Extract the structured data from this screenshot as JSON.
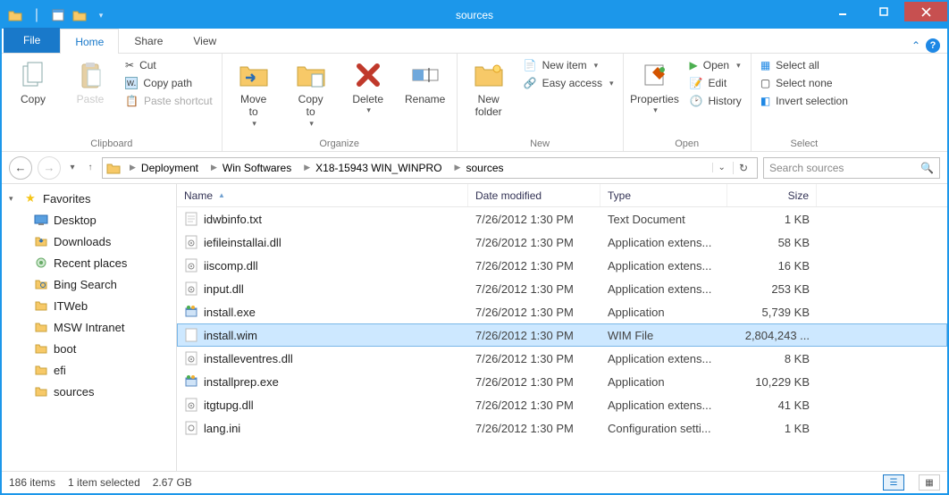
{
  "window": {
    "title": "sources"
  },
  "tabs": {
    "file": "File",
    "home": "Home",
    "share": "Share",
    "view": "View"
  },
  "ribbon": {
    "clipboard": {
      "label": "Clipboard",
      "copy": "Copy",
      "paste": "Paste",
      "cut": "Cut",
      "copy_path": "Copy path",
      "paste_shortcut": "Paste shortcut"
    },
    "organize": {
      "label": "Organize",
      "move_to": "Move\nto",
      "copy_to": "Copy\nto",
      "delete": "Delete",
      "rename": "Rename"
    },
    "new": {
      "label": "New",
      "new_folder": "New\nfolder",
      "new_item": "New item",
      "easy_access": "Easy access"
    },
    "open": {
      "label": "Open",
      "properties": "Properties",
      "open": "Open",
      "edit": "Edit",
      "history": "History"
    },
    "select": {
      "label": "Select",
      "all": "Select all",
      "none": "Select none",
      "invert": "Invert selection"
    }
  },
  "breadcrumbs": [
    "Deployment",
    "Win Softwares",
    "X18-15943 WIN_WINPRO",
    "sources"
  ],
  "search_placeholder": "Search sources",
  "nav": {
    "favorites": "Favorites",
    "items": [
      "Desktop",
      "Downloads",
      "Recent places",
      "Bing Search",
      "ITWeb",
      "MSW Intranet",
      "boot",
      "efi",
      "sources"
    ]
  },
  "columns": {
    "name": "Name",
    "date": "Date modified",
    "type": "Type",
    "size": "Size"
  },
  "files": [
    {
      "name": "idwbinfo.txt",
      "date": "7/26/2012 1:30 PM",
      "type": "Text Document",
      "size": "1 KB",
      "icon": "txt"
    },
    {
      "name": "iefileinstallai.dll",
      "date": "7/26/2012 1:30 PM",
      "type": "Application extens...",
      "size": "58 KB",
      "icon": "dll"
    },
    {
      "name": "iiscomp.dll",
      "date": "7/26/2012 1:30 PM",
      "type": "Application extens...",
      "size": "16 KB",
      "icon": "dll"
    },
    {
      "name": "input.dll",
      "date": "7/26/2012 1:30 PM",
      "type": "Application extens...",
      "size": "253 KB",
      "icon": "dll"
    },
    {
      "name": "install.exe",
      "date": "7/26/2012 1:30 PM",
      "type": "Application",
      "size": "5,739 KB",
      "icon": "exe"
    },
    {
      "name": "install.wim",
      "date": "7/26/2012 1:30 PM",
      "type": "WIM File",
      "size": "2,804,243 ...",
      "icon": "file",
      "selected": true
    },
    {
      "name": "installeventres.dll",
      "date": "7/26/2012 1:30 PM",
      "type": "Application extens...",
      "size": "8 KB",
      "icon": "dll"
    },
    {
      "name": "installprep.exe",
      "date": "7/26/2012 1:30 PM",
      "type": "Application",
      "size": "10,229 KB",
      "icon": "exe"
    },
    {
      "name": "itgtupg.dll",
      "date": "7/26/2012 1:30 PM",
      "type": "Application extens...",
      "size": "41 KB",
      "icon": "dll"
    },
    {
      "name": "lang.ini",
      "date": "7/26/2012 1:30 PM",
      "type": "Configuration setti...",
      "size": "1 KB",
      "icon": "ini"
    }
  ],
  "status": {
    "items": "186 items",
    "selected": "1 item selected",
    "size": "2.67 GB"
  }
}
